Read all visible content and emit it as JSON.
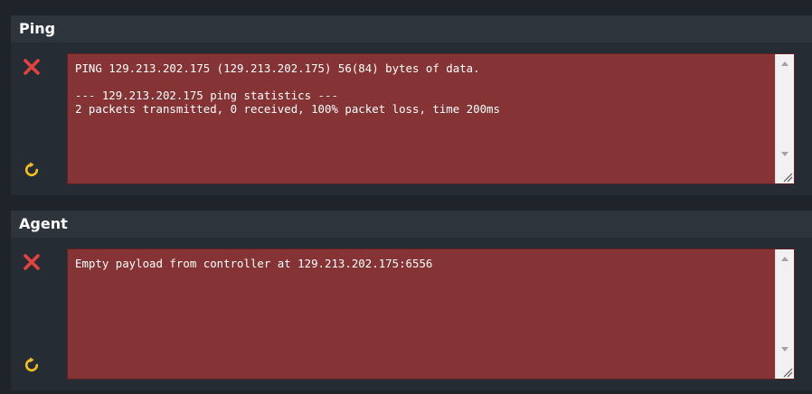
{
  "panels": [
    {
      "title": "Ping",
      "output": "PING 129.213.202.175 (129.213.202.175) 56(84) bytes of data.\n\n--- 129.213.202.175 ping statistics ---\n2 packets transmitted, 0 received, 100% packet loss, time 200ms",
      "status_icon": "close-icon",
      "action_icon": "refresh-icon"
    },
    {
      "title": "Agent",
      "output": "Empty payload from controller at 129.213.202.175:6556",
      "status_icon": "close-icon",
      "action_icon": "refresh-icon"
    }
  ],
  "colors": {
    "page_background": "#1f242b",
    "panel_background": "#262c33",
    "header_background": "#2d343c",
    "error_output_background": "#863335",
    "error_icon": "#e2433f",
    "refresh_icon": "#f2c01e"
  }
}
